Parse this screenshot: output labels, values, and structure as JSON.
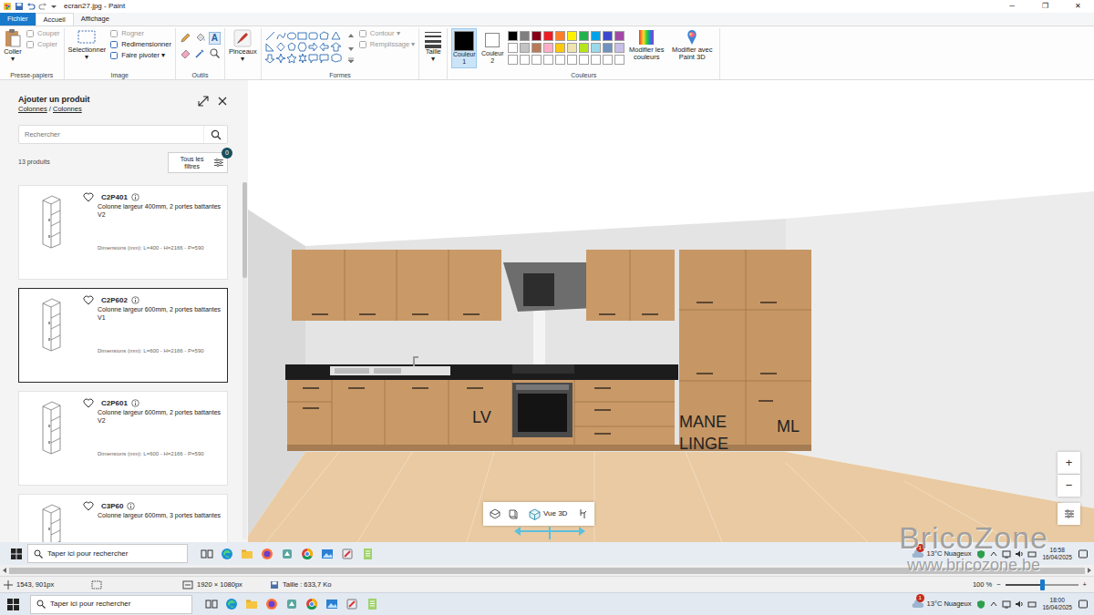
{
  "window": {
    "title": "ecran27.jpg - Paint",
    "controls": [
      "─",
      "❐",
      "✕"
    ]
  },
  "menu_tabs": [
    {
      "label": "Fichier",
      "selected": false,
      "kind": "file"
    },
    {
      "label": "Accueil",
      "selected": true,
      "kind": "tab"
    },
    {
      "label": "Affichage",
      "selected": false,
      "kind": "tab"
    }
  ],
  "ribbon": {
    "clipboard": {
      "label": "Presse-papiers",
      "paste": "Coller",
      "paste_arrow": "▾",
      "items": [
        {
          "label": "Couper",
          "disabled": true
        },
        {
          "label": "Copier",
          "disabled": true
        }
      ]
    },
    "image": {
      "label": "Image",
      "select": "Sélectionner",
      "select_arrow": "▾",
      "items": [
        {
          "label": "Rogner",
          "disabled": true
        },
        {
          "label": "Redimensionner",
          "disabled": false
        },
        {
          "label": "Faire pivoter ▾",
          "disabled": false
        }
      ]
    },
    "tools": {
      "label": "Outils",
      "text_tool": "A"
    },
    "brushes": {
      "label": "Pinceaux",
      "arrow": "▾"
    },
    "shapes": {
      "label": "Formes",
      "items": [
        {
          "label": "Contour ▾",
          "disabled": true
        },
        {
          "label": "Remplissage ▾",
          "disabled": true
        }
      ]
    },
    "size": {
      "label": "Taille",
      "arrow": "▾"
    },
    "colors": {
      "label": "Couleurs",
      "color1": {
        "label": "Couleur 1",
        "color": "#000000",
        "selected": true
      },
      "color2": {
        "label": "Couleur 2",
        "color": "#ffffff",
        "selected": false
      },
      "palette": [
        {
          "color": "#000000"
        },
        {
          "color": "#7f7f7f"
        },
        {
          "color": "#880015"
        },
        {
          "color": "#ed1c24"
        },
        {
          "color": "#ff7f27"
        },
        {
          "color": "#fff200"
        },
        {
          "color": "#22b14c"
        },
        {
          "color": "#00a2e8"
        },
        {
          "color": "#3f48cc"
        },
        {
          "color": "#a349a4"
        },
        {
          "color": "#ffffff"
        },
        {
          "color": "#c3c3c3"
        },
        {
          "color": "#b97a57"
        },
        {
          "color": "#ffaec9"
        },
        {
          "color": "#ffc90e"
        },
        {
          "color": "#efe4b0"
        },
        {
          "color": "#b5e61d"
        },
        {
          "color": "#99d9ea"
        },
        {
          "color": "#7092be"
        },
        {
          "color": "#c8bfe7"
        },
        {
          "color": "#ffffff"
        },
        {
          "color": "#ffffff"
        },
        {
          "color": "#ffffff"
        },
        {
          "color": "#ffffff"
        },
        {
          "color": "#ffffff"
        },
        {
          "color": "#ffffff"
        },
        {
          "color": "#ffffff"
        },
        {
          "color": "#ffffff"
        },
        {
          "color": "#ffffff"
        },
        {
          "color": "#ffffff"
        }
      ],
      "edit_colors": "Modifier les couleurs",
      "paint3d": "Modifier avec Paint 3D"
    }
  },
  "planner": {
    "panel": {
      "title": "Ajouter un produit",
      "breadcrumb": [
        "Colonnes",
        "Colonnes"
      ],
      "breadcrumb_sep": "/",
      "search_placeholder": "Rechercher",
      "count": "13 produits",
      "filter_button": "Tous les filtres",
      "filter_badge": "0",
      "products": [
        {
          "code": "C2P401",
          "description": "Colonne largeur 400mm, 2 portes battantes V2",
          "dimensions": "Dimensions (mm): L=400 - H=2166 - P=590",
          "selected": false,
          "favorite": false
        },
        {
          "code": "C2P602",
          "description": "Colonne largeur 600mm, 2 portes battantes V1",
          "dimensions": "Dimensions (mm): L=600 - H=2166 - P=590",
          "selected": true,
          "favorite": false
        },
        {
          "code": "C2P601",
          "description": "Colonne largeur 600mm, 2 portes battantes V2",
          "dimensions": "Dimensions (mm): L=600 - H=2166 - P=590",
          "selected": false,
          "favorite": false
        },
        {
          "code": "C3P60",
          "description": "Colonne largeur 600mm, 3 portes battantes",
          "selected": false,
          "favorite": false
        }
      ]
    },
    "view": {
      "labels": [
        {
          "lines": [
            "LV"
          ]
        },
        {
          "lines": [
            "MANE",
            "LINGE"
          ]
        },
        {
          "lines": [
            "ML"
          ]
        }
      ],
      "zoom_in": "+",
      "zoom_out": "−",
      "view_mode": "Vue 3D"
    }
  },
  "inner_taskbar": {
    "search": "Taper ici pour rechercher",
    "weather": "13°C Nuageux",
    "weather_badge": "1",
    "time": "16:58",
    "date": "16/04/2025"
  },
  "status_bar": {
    "cursor": "1543, 901px",
    "dimensions": "1920 × 1080px",
    "file_size": "Taille : 633,7 Ko",
    "zoom": "100 %",
    "zoom_out": "−",
    "zoom_in": "+",
    "zoom_level": 0.5
  },
  "taskbar": {
    "search": "Taper ici pour rechercher",
    "weather": "13°C Nuageux",
    "weather_badge": "1",
    "time": "18:00",
    "date": "16/04/2025"
  },
  "watermark": {
    "title": "BricoZone",
    "url": "www.bricozone.be"
  }
}
